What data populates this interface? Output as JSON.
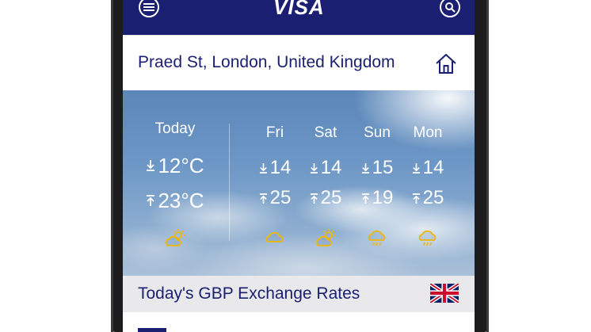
{
  "header": {
    "brand": "VISA",
    "menu_icon": "menu-icon",
    "search_icon": "search-icon"
  },
  "location": {
    "text": "Praed St, London, United Kingdom",
    "home_icon": "home-icon"
  },
  "weather": {
    "today": {
      "label": "Today",
      "min": "12°C",
      "max": "23°C",
      "icon": "partly-sunny-icon"
    },
    "forecast": [
      {
        "day": "Fri",
        "min": "14",
        "max": "25",
        "icon": "cloudy-icon"
      },
      {
        "day": "Sat",
        "min": "14",
        "max": "25",
        "icon": "partly-sunny-icon"
      },
      {
        "day": "Sun",
        "min": "15",
        "max": "19",
        "icon": "sun-rain-icon"
      },
      {
        "day": "Mon",
        "min": "14",
        "max": "25",
        "icon": "sun-rain-icon"
      }
    ]
  },
  "exchange": {
    "title": "Today's GBP Exchange Rates",
    "flag_icon": "uk-flag-icon"
  },
  "colors": {
    "brand_navy": "#1a1f71",
    "weather_icon_yellow": "#f2b705"
  }
}
